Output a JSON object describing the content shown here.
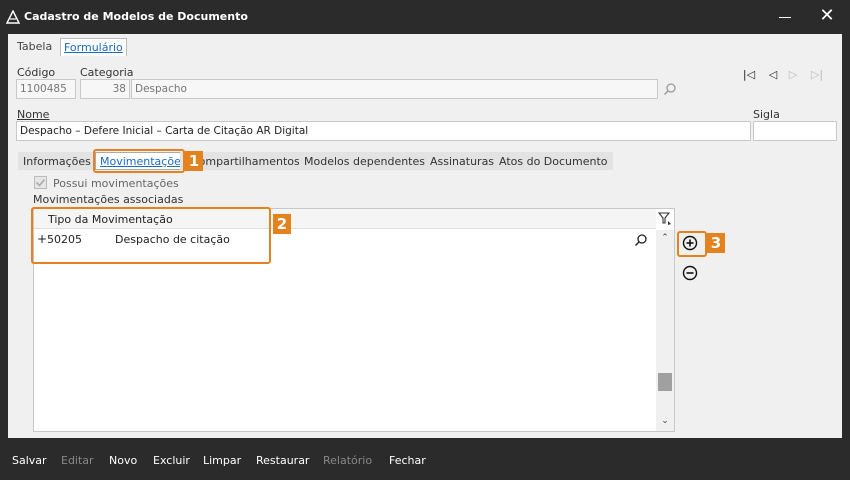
{
  "window": {
    "title": "Cadastro de Modelos de Documento"
  },
  "top_tabs": [
    {
      "label": "Tabela",
      "active": false
    },
    {
      "label": "Formulário",
      "active": true
    }
  ],
  "fields": {
    "codigo_label": "Código",
    "codigo_value": "1100485",
    "categoria_label": "Categoria",
    "categoria_code": "38",
    "categoria_name": "Despacho",
    "nome_label": "Nome",
    "nome_value": "Despacho – Defere Inicial – Carta de Citação AR Digital",
    "sigla_label": "Sigla",
    "sigla_value": ""
  },
  "sub_tabs": [
    {
      "label": "Informações",
      "active": false
    },
    {
      "label": "Movimentações",
      "active": true
    },
    {
      "label": "Compartilhamentos",
      "active": false
    },
    {
      "label": "Modelos dependentes",
      "active": false
    },
    {
      "label": "Assinaturas",
      "active": false
    },
    {
      "label": "Atos do Documento",
      "active": false
    }
  ],
  "movimentacoes": {
    "checkbox_label": "Possui movimentações",
    "section_label": "Movimentações associadas",
    "column_header": "Tipo da Movimentação",
    "rows": [
      {
        "expander": "+",
        "code": "50205",
        "description": "Despacho de citação"
      }
    ]
  },
  "callouts": [
    "1",
    "2",
    "3"
  ],
  "toolbar": [
    {
      "label": "Salvar",
      "enabled": true
    },
    {
      "label": "Editar",
      "enabled": false
    },
    {
      "label": "Novo",
      "enabled": true
    },
    {
      "label": "Excluir",
      "enabled": true
    },
    {
      "label": "Limpar",
      "enabled": true
    },
    {
      "label": "Restaurar",
      "enabled": true
    },
    {
      "label": "Relatório",
      "enabled": false
    },
    {
      "label": "Fechar",
      "enabled": true
    }
  ],
  "colors": {
    "accent": "#1a6bc1",
    "callout": "#e6821e",
    "chrome": "#2b2b2b"
  }
}
